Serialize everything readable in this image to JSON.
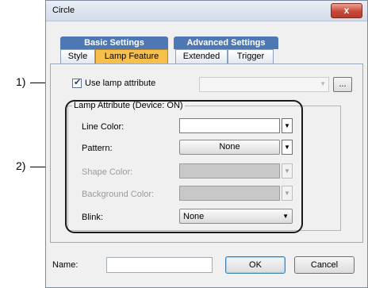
{
  "window": {
    "title": "Circle",
    "close_glyph": "x"
  },
  "tab_groups": {
    "basic": "Basic Settings",
    "advanced": "Advanced Settings"
  },
  "tabs": {
    "style": "Style",
    "lamp_feature": "Lamp Feature",
    "extended": "Extended",
    "trigger": "Trigger"
  },
  "use_lamp": {
    "label": "Use lamp attribute",
    "checked": true,
    "device_value": "",
    "browse_label": "..."
  },
  "group": {
    "title": "Lamp Attribute (Device: ON)",
    "line_color_label": "Line Color:",
    "pattern_label": "Pattern:",
    "pattern_value": "None",
    "shape_color_label": "Shape Color:",
    "background_color_label": "Background Color:",
    "blink_label": "Blink:",
    "blink_value": "None"
  },
  "callouts": {
    "one": "1)",
    "two": "2)"
  },
  "footer": {
    "name_label": "Name:",
    "name_value": "",
    "ok_label": "OK",
    "cancel_label": "Cancel"
  },
  "colors": {
    "active_tab": "#f7c04a",
    "tab_group": "#4d78b4",
    "close_button": "#c9493a",
    "disabled_swatch": "#c8c8c8"
  }
}
